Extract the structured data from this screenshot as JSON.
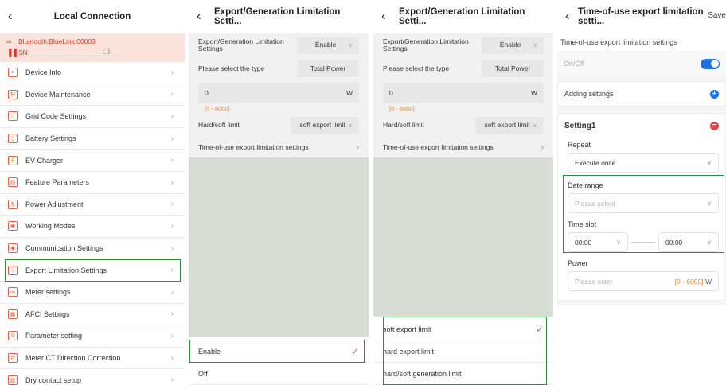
{
  "screen1": {
    "title": "Local Connection",
    "bluetooth": "Bluetooth:BlueLink:00003",
    "sn_label": "SN:",
    "menu": [
      {
        "label": "Device Info",
        "icon": "document-icon"
      },
      {
        "label": "Device Maintenance",
        "icon": "tools-icon"
      },
      {
        "label": "Grid Code Settings",
        "icon": "grid-tower-icon"
      },
      {
        "label": "Battery Settings",
        "icon": "battery-icon"
      },
      {
        "label": "EV Charger",
        "icon": "ev-charger-icon"
      },
      {
        "label": "Feature Parameters",
        "icon": "feature-icon"
      },
      {
        "label": "Power Adjustment",
        "icon": "power-adjust-icon"
      },
      {
        "label": "Working Modes",
        "icon": "working-mode-icon"
      },
      {
        "label": "Communication Settings",
        "icon": "antenna-icon"
      },
      {
        "label": "Export Limitation Settings",
        "icon": "export-limit-icon"
      },
      {
        "label": "Meter settings",
        "icon": "meter-icon"
      },
      {
        "label": "AFCI Settings",
        "icon": "afci-icon"
      },
      {
        "label": "Parameter setting",
        "icon": "parameter-icon"
      },
      {
        "label": "Meter CT Direction Correction",
        "icon": "ct-icon"
      },
      {
        "label": "Dry contact setup",
        "icon": "dry-contact-icon"
      }
    ]
  },
  "screen2": {
    "title": "Export/Generation Limitation Setti...",
    "limit_label": "Export/Generation Limitation Settings",
    "limit_value": "Enable",
    "type_label": "Please select the type",
    "type_value": "Total Power",
    "power_value": "0",
    "power_unit": "W",
    "power_range": "[0 - 6000]",
    "hardsoft_label": "Hard/soft limit",
    "hardsoft_value": "soft export limit",
    "tou_label": "Time-of-use export limitation settings",
    "sheet_options": [
      "Enable",
      "Off"
    ]
  },
  "screen3": {
    "title": "Export/Generation Limitation Setti...",
    "limit_label": "Export/Generation Limitation Settings",
    "limit_value": "Enable",
    "type_label": "Please select the type",
    "type_value": "Total Power",
    "power_value": "0",
    "power_unit": "W",
    "power_range": "[0 - 6000]",
    "hardsoft_label": "Hard/soft limit",
    "hardsoft_value": "soft export limit",
    "tou_label": "Time-of-use export limitation settings",
    "sheet_options": [
      "soft export limit",
      "hard export limit",
      "hard/soft generation limit"
    ]
  },
  "screen4": {
    "title": "Time-of-use export limitation setti...",
    "save": "Save",
    "subtitle": "Time-of-use export limitation settings",
    "onoff_label": "On/Off",
    "onoff_state": "on",
    "adding_label": "Adding settings",
    "setting_title": "Setting1",
    "repeat_label": "Repeat",
    "repeat_value": "Execute once",
    "date_label": "Date range",
    "date_placeholder": "Please select",
    "timeslot_label": "Time slot",
    "time_start": "00:00",
    "time_end": "00:00",
    "power_label": "Power",
    "power_placeholder": "Please enter",
    "power_range": "[0 - 6000]",
    "power_unit": "W"
  },
  "colors": {
    "accent": "#e2603e",
    "highlight_box": "#2e8b3e",
    "toggle": "#1e6fe0",
    "range_text": "#e08a2e",
    "delete": "#e04545"
  }
}
